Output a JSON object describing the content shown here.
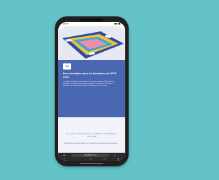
{
  "status": {
    "time": "10:35"
  },
  "card": {
    "logo": "ifffe",
    "title": "Bien orientation dans les formations de l'IFFE Auvo",
    "body": "Ce labytrin fait intitulé sur le contenu de ce que vous comptez l'IFFE dans vos formations, et déplaisez-vous par vos méthodes, la l'aide pour vos choix de formations, les orientations de l'IFFE sur des questions du contenu."
  },
  "light": {
    "text": "Vos envies, votre expérience, vos diplômes ou qualifications, votre profil.",
    "text2": "Bénéficiez de nos dispositifs, soit consultation en présentiel ou à distance."
  },
  "browser": {
    "aa": "AA",
    "url": "formulaffee.com",
    "reload": "↻"
  },
  "nav": {
    "back": "‹",
    "forward": "›",
    "share": "⇪",
    "bookmarks": "▭",
    "tabs": "⧉"
  }
}
